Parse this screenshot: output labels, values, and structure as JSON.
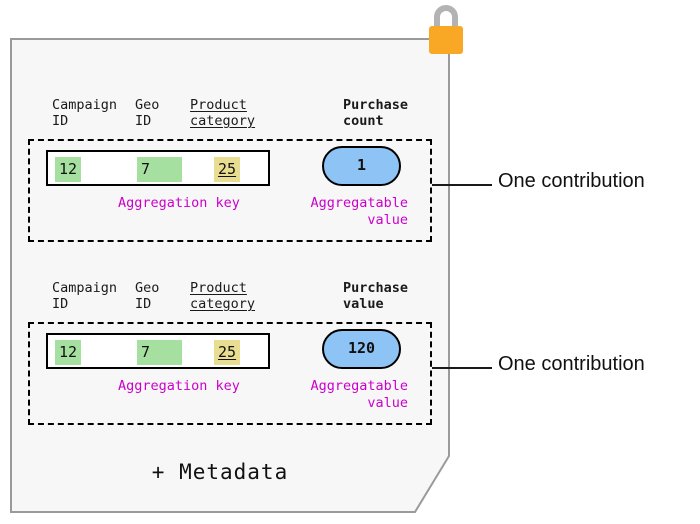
{
  "card": {
    "lock_icon": "lock-closed-icon",
    "background_color": "#f7f7f7",
    "metadata_label": "+ Metadata"
  },
  "colors": {
    "key_highlight_green": "#a5e0a0",
    "key_highlight_yellow": "#e9dd91",
    "value_pill_blue": "#8ec4f5",
    "caption_purple": "#cc00cc",
    "lock_body_orange": "#f9a825",
    "lock_shackle_gray": "#b3b3b3",
    "outline_black": "#000000"
  },
  "contributions": [
    {
      "headers": {
        "campaign": "Campaign\nID",
        "geo": "Geo\nID",
        "product": "Product\ncategory",
        "metric": "Purchase\ncount"
      },
      "key_values": {
        "campaign_id": "12",
        "geo_id": "7",
        "product_category": "25"
      },
      "aggregatable_value": "1",
      "captions": {
        "key": "Aggregation key",
        "value": "Aggregatable\nvalue"
      },
      "callout": "One contribution"
    },
    {
      "headers": {
        "campaign": "Campaign\nID",
        "geo": "Geo\nID",
        "product": "Product\ncategory",
        "metric": "Purchase\nvalue"
      },
      "key_values": {
        "campaign_id": "12",
        "geo_id": "7",
        "product_category": "25"
      },
      "aggregatable_value": "120",
      "captions": {
        "key": "Aggregation key",
        "value": "Aggregatable\nvalue"
      },
      "callout": "One contribution"
    }
  ]
}
